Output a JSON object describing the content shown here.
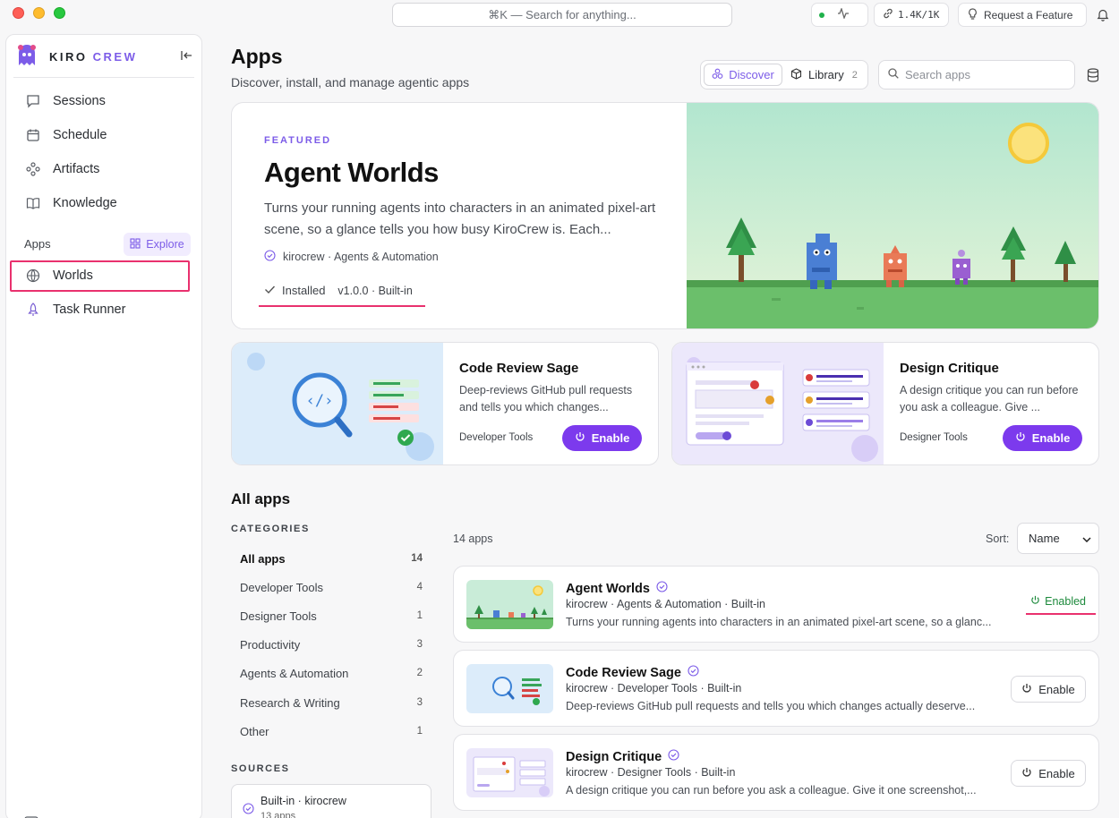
{
  "window": {
    "command_placeholder": "⌘K — Search for anything...",
    "usage": "1.4K/1K",
    "request_feature": "Request a Feature"
  },
  "brand": {
    "part1": "KIRO",
    "part2": "CREW"
  },
  "sidebar": {
    "items": [
      {
        "label": "Sessions",
        "icon": "chat-icon"
      },
      {
        "label": "Schedule",
        "icon": "calendar-icon"
      },
      {
        "label": "Artifacts",
        "icon": "artifacts-icon"
      },
      {
        "label": "Knowledge",
        "icon": "book-icon"
      }
    ],
    "apps_label": "Apps",
    "explore_label": "Explore",
    "apps": [
      {
        "label": "Worlds",
        "icon": "globe-icon"
      },
      {
        "label": "Task Runner",
        "icon": "rocket-icon"
      }
    ]
  },
  "header": {
    "title": "Apps",
    "subtitle": "Discover, install, and manage agentic apps",
    "tab_discover": "Discover",
    "tab_library": "Library",
    "library_count": "2",
    "search_placeholder": "Search apps"
  },
  "featured": {
    "eyebrow": "FEATURED",
    "title": "Agent Worlds",
    "description": "Turns your running agents into characters in an animated pixel-art scene, so a glance tells you how busy KiroCrew is. Each...",
    "meta": "kirocrew · Agents & Automation",
    "installed": "Installed",
    "version": "v1.0.0 · Built-in"
  },
  "cards": [
    {
      "title": "Code Review Sage",
      "description": "Deep-reviews GitHub pull requests and tells you which changes...",
      "category": "Developer Tools",
      "button": "Enable"
    },
    {
      "title": "Design Critique",
      "description": "A design critique you can run before you ask a colleague. Give ...",
      "category": "Designer Tools",
      "button": "Enable"
    }
  ],
  "all_apps": {
    "title": "All apps",
    "categories_heading": "CATEGORIES",
    "categories": [
      {
        "label": "All apps",
        "count": "14"
      },
      {
        "label": "Developer Tools",
        "count": "4"
      },
      {
        "label": "Designer Tools",
        "count": "1"
      },
      {
        "label": "Productivity",
        "count": "3"
      },
      {
        "label": "Agents & Automation",
        "count": "2"
      },
      {
        "label": "Research & Writing",
        "count": "3"
      },
      {
        "label": "Other",
        "count": "1"
      }
    ],
    "sources_heading": "SOURCES",
    "source": {
      "label": "Built-in · kirocrew",
      "count": "13 apps"
    },
    "count_label": "14 apps",
    "sort_label": "Sort:",
    "sort_value": "Name",
    "list": [
      {
        "name": "Agent Worlds",
        "meta": "kirocrew · Agents & Automation · Built-in",
        "description": "Turns your running agents into characters in an animated pixel-art scene, so a glanc...",
        "action": "Enabled"
      },
      {
        "name": "Code Review Sage",
        "meta": "kirocrew · Developer Tools · Built-in",
        "description": "Deep-reviews GitHub pull requests and tells you which changes actually deserve...",
        "action": "Enable"
      },
      {
        "name": "Design Critique",
        "meta": "kirocrew · Designer Tools · Built-in",
        "description": "A design critique you can run before you ask a colleague. Give it one screenshot,...",
        "action": "Enable"
      }
    ]
  },
  "colors": {
    "accent": "#7c3aed",
    "highlight": "#e9316e",
    "enabled": "#1d8a3c"
  }
}
